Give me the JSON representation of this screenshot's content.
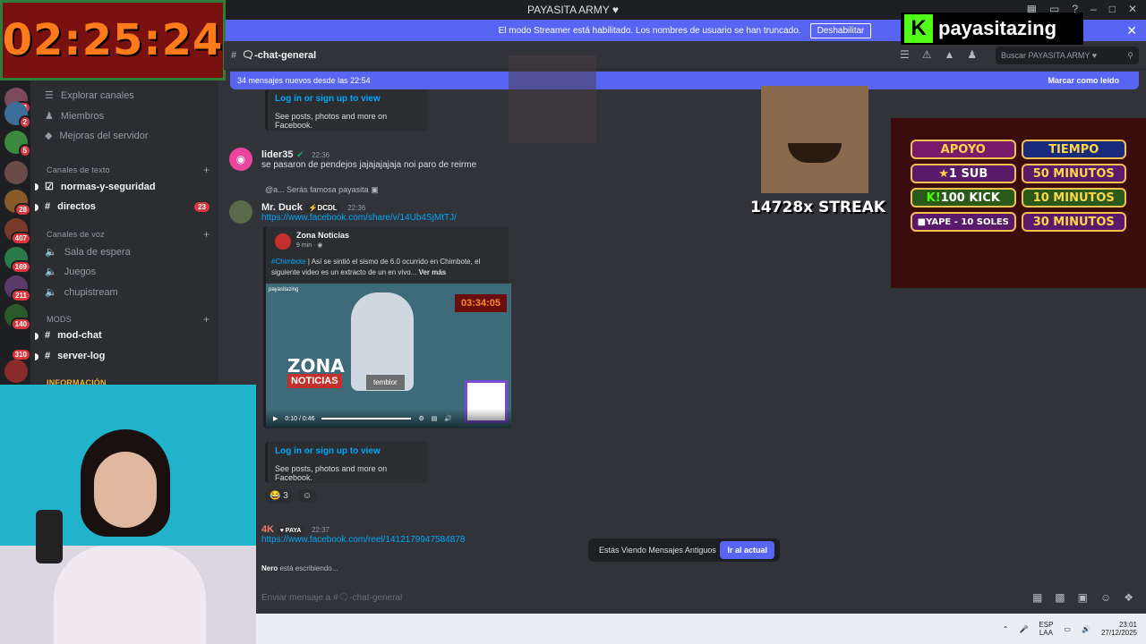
{
  "window": {
    "title": "PAYASITA ARMY ♥"
  },
  "streamer_banner": {
    "text": "El modo Streamer está habilitado. Los nombres de usuario se han truncado.",
    "button": "Deshabilitar"
  },
  "overlay": {
    "timer": "02:25:24",
    "kick_name": "payasitazing",
    "streak": "14728x STREAK"
  },
  "support": {
    "header": [
      "APOYO",
      "TIEMPO"
    ],
    "rows": [
      {
        "left": "1 SUB",
        "right": "50 MINUTOS"
      },
      {
        "left": "100 KICK",
        "right": "10 MINUTOS"
      },
      {
        "left": "YAPE - 10 SOLES",
        "right": "30 MINUTOS"
      }
    ]
  },
  "sidebar": {
    "top_items": [
      {
        "label": "Explorar canales"
      },
      {
        "label": "Miembros"
      },
      {
        "label": "Mejoras del servidor"
      }
    ],
    "cat_text": "Canales de texto",
    "text_channels": [
      {
        "label": "normas-y-seguridad"
      },
      {
        "label": "directos",
        "badge": "23"
      }
    ],
    "cat_voice": "Canales de voz",
    "voice_channels": [
      {
        "label": "Sala de espera"
      },
      {
        "label": "Juegos"
      },
      {
        "label": "chupistream"
      }
    ],
    "cat_mods": "MODS",
    "mod_channels": [
      {
        "label": "mod-chat"
      },
      {
        "label": "server-log"
      }
    ],
    "cat_info": "INFORMACIÓN"
  },
  "guild_badges": [
    "23",
    "2",
    "5",
    "28",
    "407",
    "169",
    "211",
    "140",
    "310"
  ],
  "channel_header": {
    "name": "🗨-chat-general",
    "search": "Buscar PAYASITA ARMY ♥"
  },
  "new_messages_bar": {
    "text": "34 mensajes nuevos desde las 22:54",
    "action": "Marcar como leído"
  },
  "messages": {
    "fb_login": "Log in or sign up to view",
    "fb_sub": "See posts, photos and more on Facebook.",
    "m1": {
      "author": "lider35",
      "time": "22:36",
      "text": "se pasaron de pendejos  jajajajajaja noi paro de reirme"
    },
    "m2": {
      "reply": "@a... Serás famosa payasita",
      "author": "Mr. Duck",
      "tag": "DCDL",
      "time": "22:36",
      "link": "https://www.facebook.com/share/v/14Ub4SjMtTJ/",
      "embed_source": "Zona Noticias",
      "embed_meta": "9 min ·",
      "embed_hashtag": "#Chimbote",
      "embed_text": " | Así se sintió el sismo de 6.0 ocurrido en Chimbote, el siguiente video es un extracto de un en vivo...",
      "embed_more": "Ver más",
      "video_time": "0:10 / 0:46",
      "video_brand": "payasitazing",
      "video_timer": "03:34:05",
      "video_title1": "ZONA",
      "video_title2": "NOTICIAS",
      "video_caption": "temblor",
      "reaction_count": "3"
    },
    "m3": {
      "author": "4K",
      "tag": "PAYA",
      "time": "22:37",
      "link": "https://www.facebook.com/reel/1412179947584878"
    }
  },
  "typing": {
    "user": "Nero",
    "text": " está escribiendo..."
  },
  "old_messages": {
    "text": "Estás Viendo Mensajes Antiguos",
    "button": "Ir al actual"
  },
  "composer": {
    "placeholder": "Enviar mensaje a #🗨-chat-general"
  },
  "taskbar": {
    "lang1": "ESP",
    "lang2": "LAA",
    "time": "23:01",
    "date": "27/12/2025"
  }
}
